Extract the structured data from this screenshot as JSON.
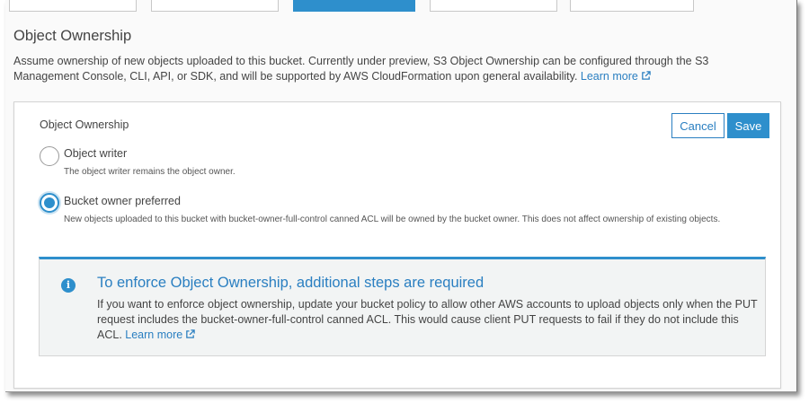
{
  "section": {
    "title": "Object Ownership",
    "description": "Assume ownership of new objects uploaded to this bucket. Currently under preview, S3 Object Ownership can be configured through the S3 Management Console, CLI, API, or SDK, and will be supported by AWS CloudFormation upon general availability.",
    "learn_more": "Learn more"
  },
  "card": {
    "label": "Object Ownership",
    "cancel_label": "Cancel",
    "save_label": "Save",
    "options": [
      {
        "title": "Object writer",
        "description": "The object writer remains the object owner.",
        "selected": false
      },
      {
        "title": "Bucket owner preferred",
        "description": "New objects uploaded to this bucket with bucket-owner-full-control canned ACL will be owned by the bucket owner. This does not affect ownership of existing objects.",
        "selected": true
      }
    ]
  },
  "alert": {
    "icon": "info-icon",
    "title": "To enforce Object Ownership, additional steps are required",
    "body": "If you want to enforce object ownership, update your bucket policy to allow other AWS accounts to upload objects only when the PUT request includes the bucket-owner-full-control canned ACL. This would cause client PUT requests to fail if they do not include this ACL.",
    "learn_more": "Learn more"
  },
  "colors": {
    "accent": "#2e8fcc",
    "link": "#2a7fc1",
    "alert_bg": "#f2f4f4"
  }
}
